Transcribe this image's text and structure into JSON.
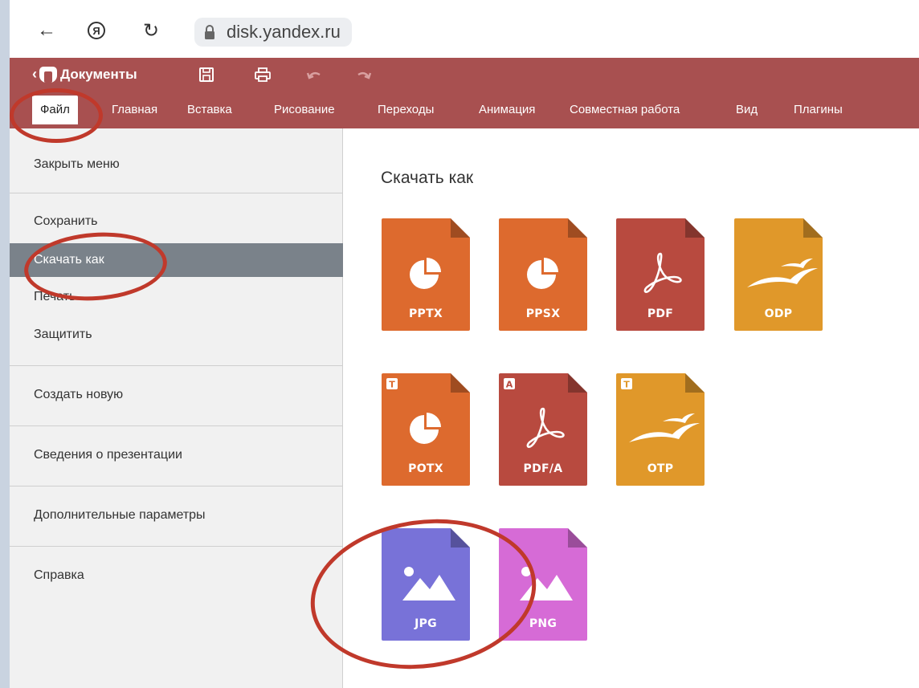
{
  "browser": {
    "url": "disk.yandex.ru",
    "back_icon": "arrow-left-icon",
    "yandex_glyph": "Я",
    "reload_icon": "reload-icon"
  },
  "app": {
    "doc_title": "Документы",
    "doc_chevron": "‹",
    "menu_tabs": [
      "Файл",
      "Главная",
      "Вставка",
      "Рисование",
      "Переходы",
      "Анимация",
      "Совместная работа",
      "Вид",
      "Плагины"
    ]
  },
  "side_menu": {
    "items": [
      "Закрыть меню",
      "Сохранить",
      "Скачать как",
      "Печать",
      "Защитить",
      "Создать новую",
      "Сведения о презентации",
      "Дополнительные параметры",
      "Справка"
    ],
    "active": "Скачать как"
  },
  "download": {
    "title": "Скачать как",
    "formats": [
      {
        "label": "PPTX",
        "icon": "pie-icon",
        "color": "#dd6a2e",
        "badge": ""
      },
      {
        "label": "PPSX",
        "icon": "pie-icon",
        "color": "#dd6a2e",
        "badge": ""
      },
      {
        "label": "PDF",
        "icon": "acrobat-icon",
        "color": "#b84a3f",
        "badge": ""
      },
      {
        "label": "ODP",
        "icon": "gulls-icon",
        "color": "#e0982a",
        "badge": ""
      },
      {
        "label": "POTX",
        "icon": "pie-icon",
        "color": "#dd6a2e",
        "badge": "T"
      },
      {
        "label": "PDF/A",
        "icon": "acrobat-icon",
        "color": "#b84a3f",
        "badge": "A"
      },
      {
        "label": "OTP",
        "icon": "gulls-icon",
        "color": "#e0982a",
        "badge": "T"
      },
      {
        "label": "JPG",
        "icon": "image-icon",
        "color": "#7872d8",
        "badge": ""
      },
      {
        "label": "PNG",
        "icon": "image-icon",
        "color": "#d66bd6",
        "badge": ""
      }
    ]
  },
  "colors": {
    "header": "#a85050",
    "annotation": "#c0392b"
  }
}
